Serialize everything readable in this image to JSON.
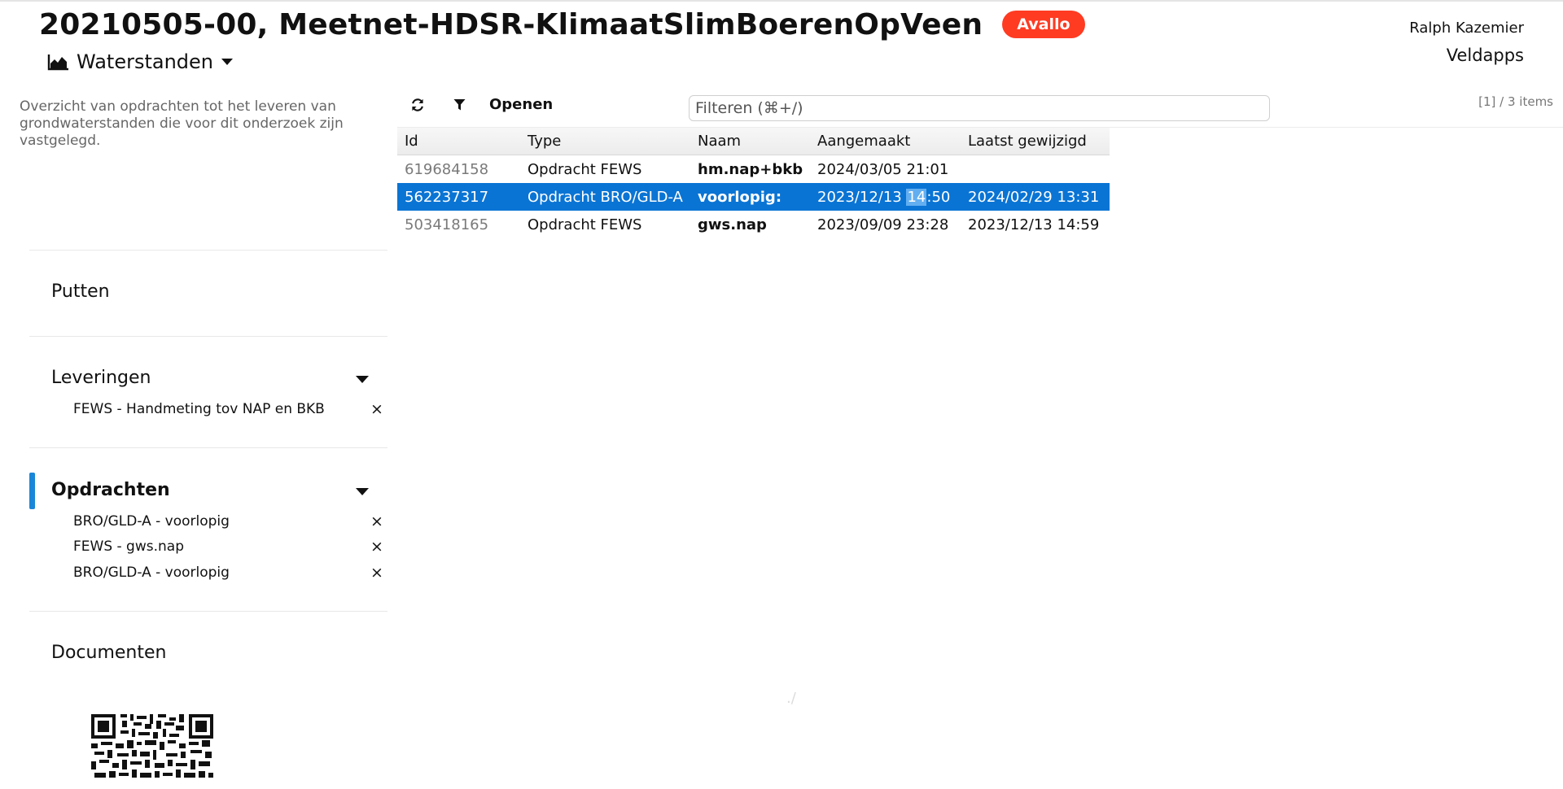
{
  "header": {
    "title": "20210505-00, Meetnet-HDSR-KlimaatSlimBoerenOpVeen",
    "badge": "Avallo",
    "section_label": "Waterstanden",
    "user": "Ralph Kazemier",
    "app": "Veldapps"
  },
  "sidebar": {
    "description": "Overzicht van opdrachten tot het leveren van grondwaterstanden die voor dit onderzoek zijn vastgelegd.",
    "putten": "Putten",
    "leveringen": {
      "label": "Leveringen",
      "items": [
        "FEWS - Handmeting tov NAP en BKB"
      ]
    },
    "opdrachten": {
      "label": "Opdrachten",
      "items": [
        "BRO/GLD-A - voorlopig",
        "FEWS - gws.nap",
        "BRO/GLD-A - voorlopig"
      ]
    },
    "documenten": "Documenten",
    "remove_glyph": "×",
    "accent_color": "#1a86d8"
  },
  "toolbar": {
    "refresh_icon": "refresh-icon",
    "filter_icon": "funnel-icon",
    "open_label": "Openen",
    "filter_placeholder": "Filteren (⌘+/)",
    "count": "[1] / 3 items"
  },
  "table": {
    "columns": [
      "Id",
      "Type",
      "Naam",
      "Aangemaakt",
      "Laatst gewijzigd"
    ],
    "rows": [
      {
        "id": "619684158",
        "type": "Opdracht FEWS",
        "naam": "hm.nap+bkb",
        "aangemaakt": "2024/03/05 21:01",
        "laatst": ""
      },
      {
        "id": "562237317",
        "type": "Opdracht BRO/GLD-A",
        "naam": "voorlopig:",
        "aangemaakt_pre": "2023/12/13 ",
        "aangemaakt_sel": "14",
        "aangemaakt_post": ":50",
        "laatst": "2024/02/29 13:31"
      },
      {
        "id": "503418165",
        "type": "Opdracht FEWS",
        "naam": "gws.nap",
        "aangemaakt": "2023/09/09 23:28",
        "laatst": "2023/12/13 14:59"
      }
    ],
    "selected_color": "#0a74d4"
  },
  "footer": {
    "faint_mark": "./"
  }
}
